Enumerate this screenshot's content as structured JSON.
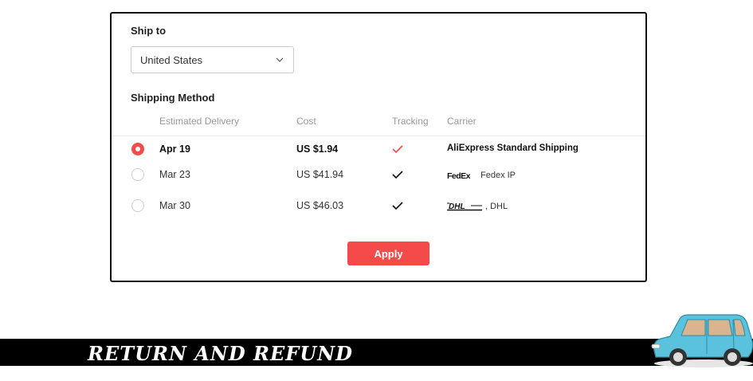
{
  "ship_to": {
    "label": "Ship to",
    "selected_country": "United States"
  },
  "shipping_method": {
    "label": "Shipping Method",
    "columns": [
      "Estimated Delivery",
      "Cost",
      "Tracking",
      "Carrier"
    ],
    "options": [
      {
        "selected": true,
        "delivery": "Apr 19",
        "cost": "US $1.94",
        "tracking": true,
        "carrier": "AliExpress Standard Shipping",
        "carrier_logo": ""
      },
      {
        "selected": false,
        "delivery": "Mar 23",
        "cost": "US $41.94",
        "tracking": true,
        "carrier": "Fedex IP",
        "carrier_logo": "FedEx"
      },
      {
        "selected": false,
        "delivery": "Mar 30",
        "cost": "US $46.03",
        "tracking": true,
        "carrier": ", DHL",
        "carrier_logo": "DHL"
      }
    ]
  },
  "apply_label": "Apply",
  "banner": {
    "title": "RETURN AND REFUND",
    "car_icon": "car-icon"
  },
  "colors": {
    "accent": "#f44a4a",
    "banner_bg": "#000000",
    "car_body": "#5bc2dd"
  }
}
